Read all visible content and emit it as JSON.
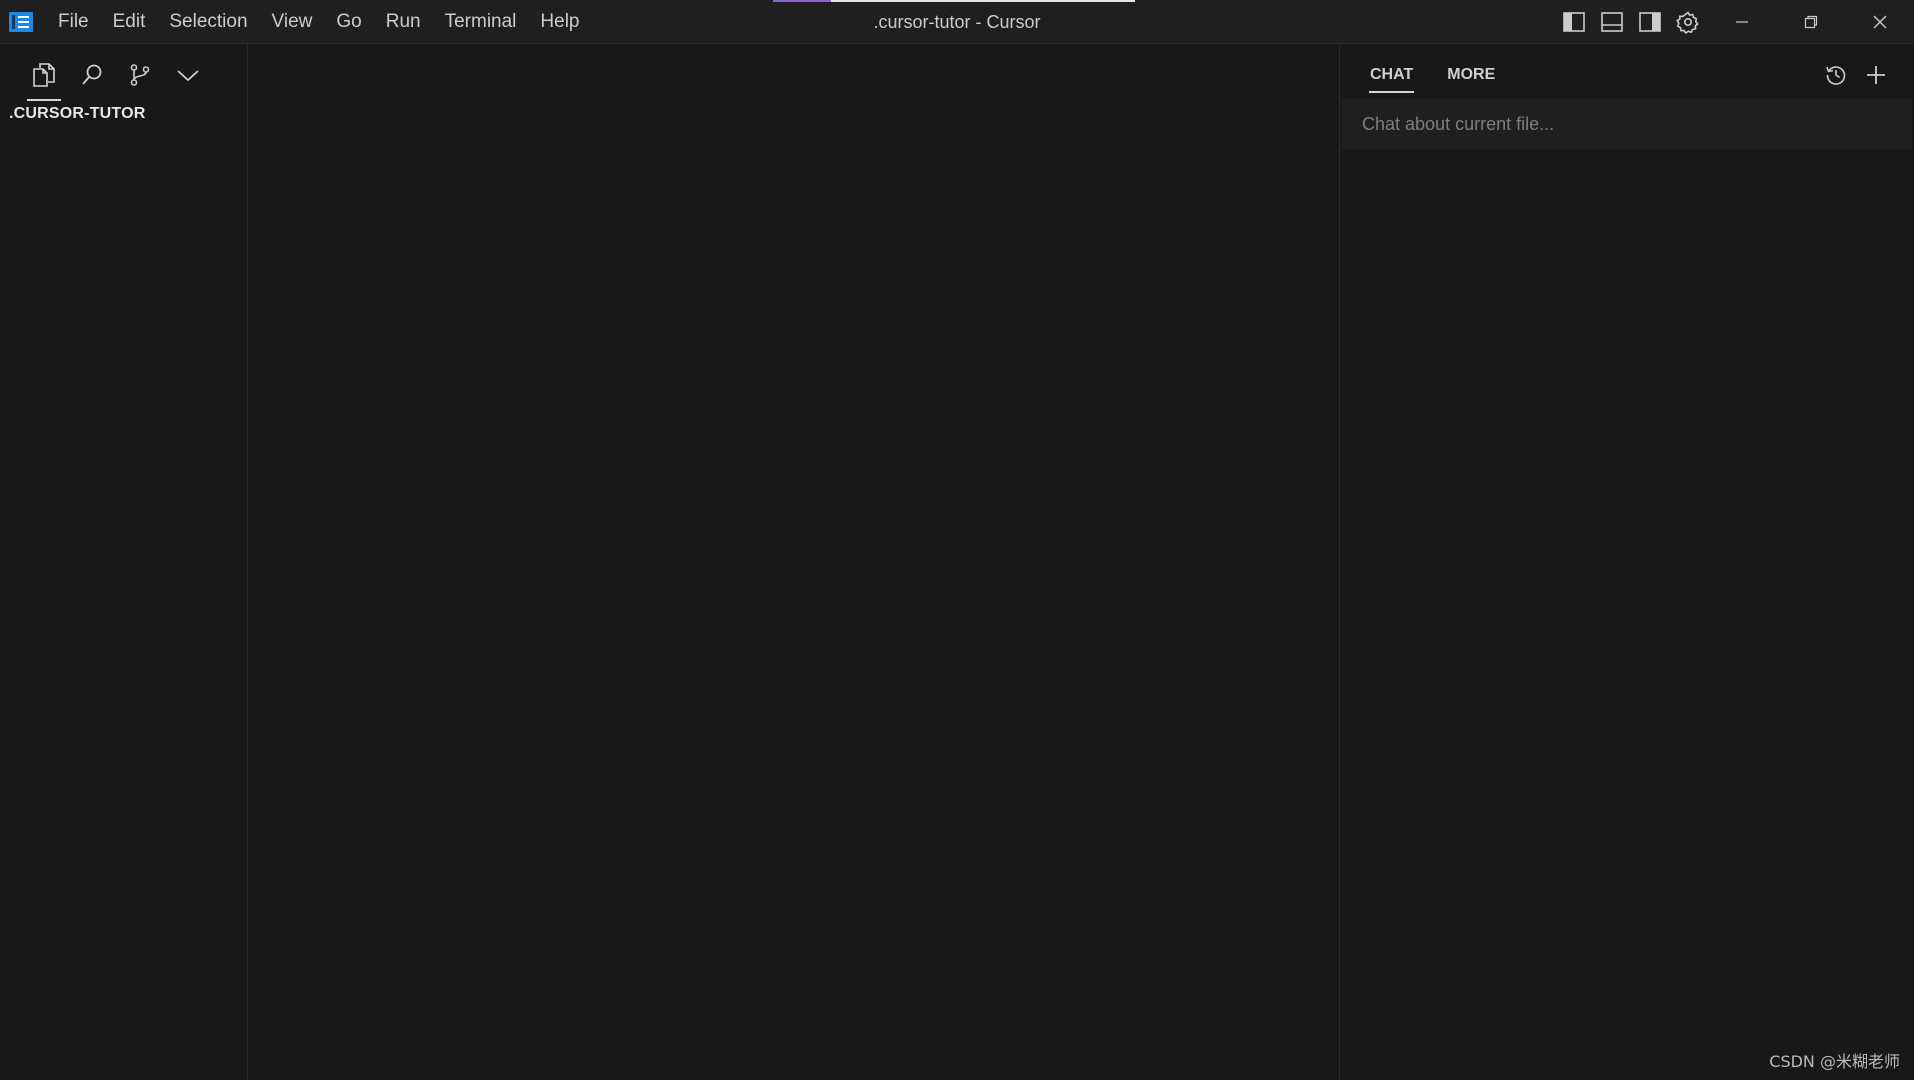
{
  "window": {
    "title": ".cursor-tutor - Cursor",
    "loading_progress": 0.16
  },
  "menu": [
    "File",
    "Edit",
    "Selection",
    "View",
    "Go",
    "Run",
    "Terminal",
    "Help"
  ],
  "title_icons": {
    "app": "cursor-logo-icon",
    "toggle_primary_sidebar": "layout-sidebar-left-icon",
    "toggle_panel": "layout-panel-icon",
    "toggle_secondary_sidebar": "layout-sidebar-right-icon",
    "settings": "gear-icon",
    "minimize": "minimize-icon",
    "restore": "restore-icon",
    "close": "close-icon"
  },
  "sidebar": {
    "tabs": [
      {
        "icon": "files-icon",
        "active": true
      },
      {
        "icon": "search-icon",
        "active": false
      },
      {
        "icon": "source-control-icon",
        "active": false
      },
      {
        "icon": "chevron-down-icon",
        "active": false
      }
    ],
    "folder_name": ".CURSOR-TUTOR"
  },
  "chat": {
    "tabs": [
      {
        "label": "CHAT",
        "active": true
      },
      {
        "label": "MORE",
        "active": false
      }
    ],
    "history_icon": "history-icon",
    "new_chat_icon": "plus-icon",
    "input_placeholder": "Chat about current file..."
  },
  "watermark": "CSDN @米糊老师",
  "colors": {
    "background": "#181818",
    "titlebar": "#1f1f1f",
    "accent_progress": "#8a63d2",
    "logo_blue": "#1e88e5"
  }
}
